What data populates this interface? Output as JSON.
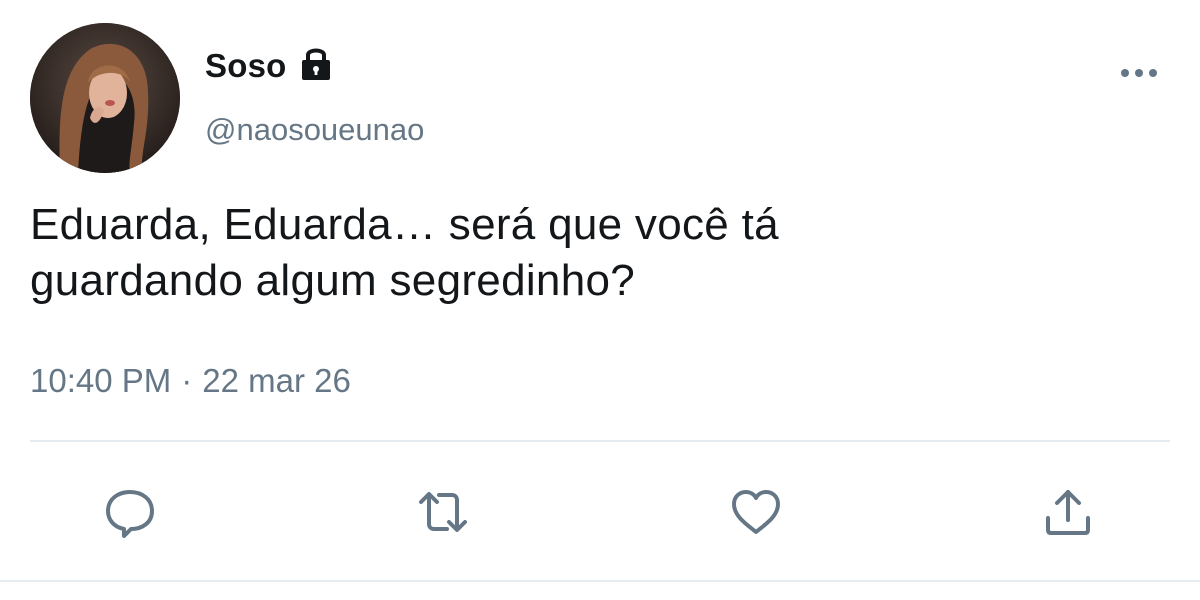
{
  "tweet": {
    "display_name": "Soso",
    "handle": "@naosoueunao",
    "protected": true,
    "text_line1": "Eduarda, Eduarda… será que você tá",
    "text_line2": "guardando algum segredinho?",
    "time": "10:40 PM",
    "separator": "·",
    "date": "22 mar 26"
  },
  "icons": {
    "lock": "lock-icon",
    "more": "more-icon",
    "reply": "reply-icon",
    "retweet": "retweet-icon",
    "like": "heart-icon",
    "share": "share-icon"
  },
  "colors": {
    "text": "#14171a",
    "secondary": "#657786",
    "icon": "#657786",
    "divider": "#e6ecf0"
  }
}
